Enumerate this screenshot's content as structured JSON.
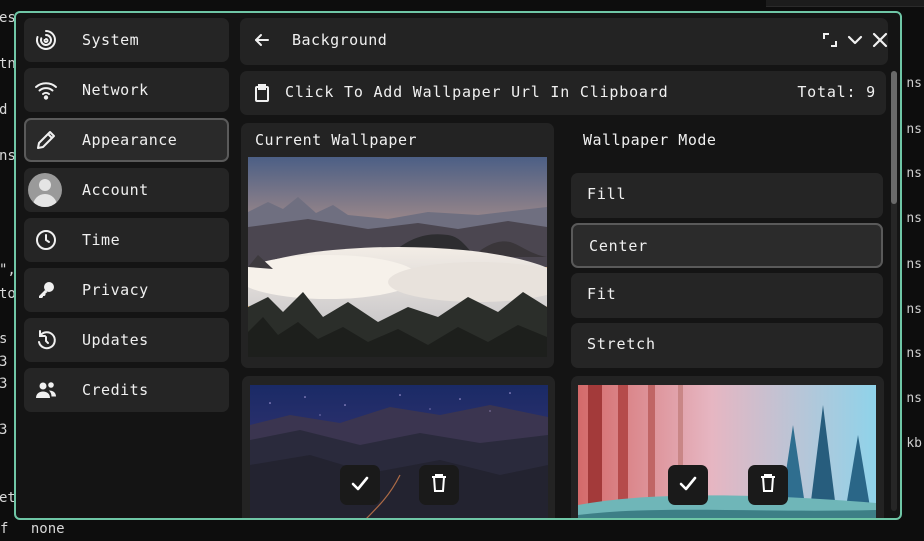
{
  "header": {
    "title": "Background"
  },
  "sidebar": {
    "items": [
      {
        "label": "System"
      },
      {
        "label": "Network"
      },
      {
        "label": "Appearance"
      },
      {
        "label": "Account"
      },
      {
        "label": "Time"
      },
      {
        "label": "Privacy"
      },
      {
        "label": "Updates"
      },
      {
        "label": "Credits"
      }
    ]
  },
  "clipboard": {
    "text": "Click To Add Wallpaper Url In Clipboard",
    "total": "Total: 9"
  },
  "current": {
    "label": "Current Wallpaper"
  },
  "mode": {
    "label": "Wallpaper Mode",
    "options": [
      {
        "label": "Fill"
      },
      {
        "label": "Center"
      },
      {
        "label": "Fit"
      },
      {
        "label": "Stretch"
      }
    ],
    "selected": "Center"
  },
  "icons": {
    "back": "arrow-left-icon",
    "fullscreen": "expand-icon",
    "minimize": "chevron-down-icon",
    "close": "close-icon",
    "system": "system-swirl-icon",
    "network": "wifi-icon",
    "appearance": "pencil-icon",
    "account": "avatar",
    "time": "clock-icon",
    "privacy": "key-icon",
    "updates": "refresh-icon",
    "credits": "people-icon",
    "clipboard": "clipboard-icon",
    "apply": "check-icon",
    "delete": "trash-icon"
  },
  "colors": {
    "border": "#6fc6a6",
    "panel": "#232323",
    "background": "#141414"
  },
  "background_terminal": {
    "left": [
      "es",
      "tn",
      "d",
      "ns",
      "\",\"",
      "to",
      "s",
      "3",
      "3",
      "3",
      "et",
      "f"
    ],
    "right": [
      "ns",
      "ns",
      "ns",
      "ns",
      "ns",
      "ns",
      "ns",
      "ns",
      "kb",
      "ns"
    ],
    "bottom": "none"
  }
}
